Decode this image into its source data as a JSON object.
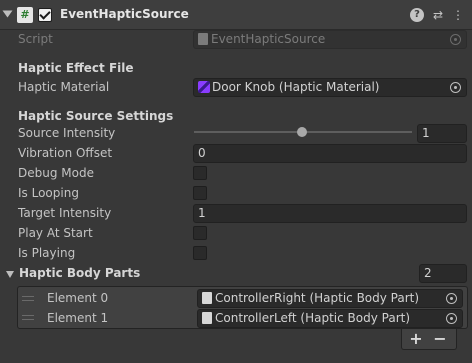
{
  "component": {
    "title": "EventHapticSource",
    "enabled": true,
    "script_icon_text": "#"
  },
  "header_icons": {
    "help": "?",
    "presets": "⇄",
    "more": "⋮"
  },
  "script": {
    "label": "Script",
    "value": "EventHapticSource"
  },
  "haptic_effect_file": {
    "section": "Haptic Effect File",
    "material_label": "Haptic Material",
    "material_value": "Door Knob (Haptic Material)"
  },
  "haptic_source_settings": {
    "section": "Haptic Source Settings",
    "source_intensity_label": "Source Intensity",
    "source_intensity_value": "1",
    "source_intensity_slider_level": 0.5,
    "vibration_offset_label": "Vibration Offset",
    "vibration_offset_value": "0",
    "debug_mode_label": "Debug Mode",
    "debug_mode_checked": false,
    "is_looping_label": "Is Looping",
    "is_looping_checked": false,
    "target_intensity_label": "Target Intensity",
    "target_intensity_value": "1",
    "play_at_start_label": "Play At Start",
    "play_at_start_checked": false,
    "is_playing_label": "Is Playing",
    "is_playing_checked": false
  },
  "haptic_body_parts": {
    "label": "Haptic Body Parts",
    "count": "2",
    "elements": [
      {
        "label": "Element 0",
        "value": "ControllerRight (Haptic Body Part)"
      },
      {
        "label": "Element 1",
        "value": "ControllerLeft (Haptic Body Part)"
      }
    ],
    "add_label": "+",
    "remove_label": "−"
  }
}
